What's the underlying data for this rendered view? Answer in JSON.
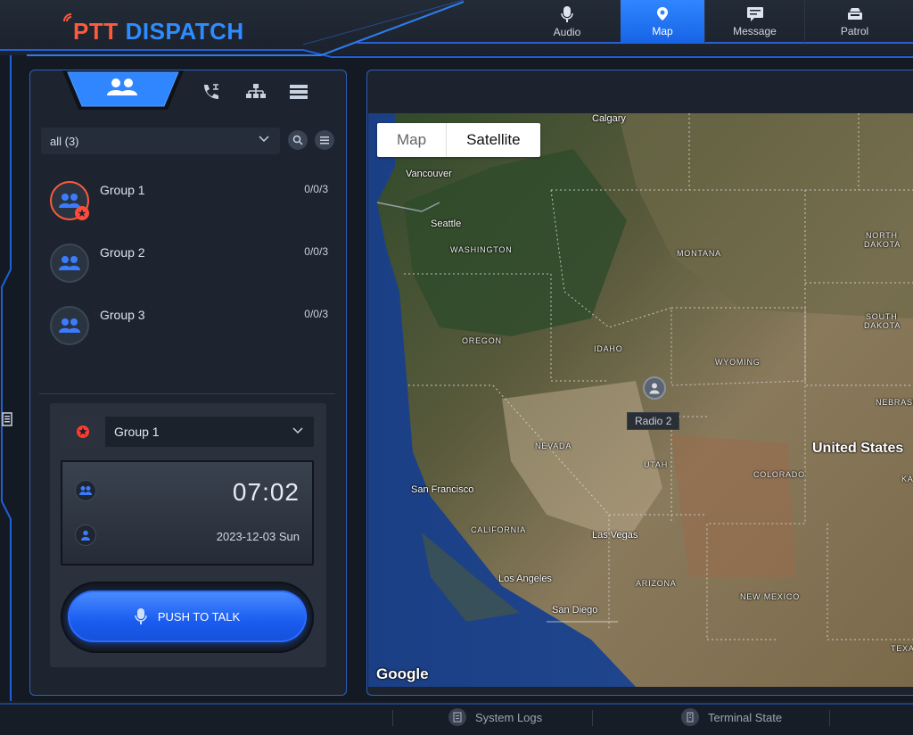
{
  "app": {
    "logo_ptt": "PTT",
    "logo_dispatch": "DISPATCH"
  },
  "nav": [
    {
      "label": "Audio",
      "icon": "microphone-icon"
    },
    {
      "label": "Map",
      "icon": "map-pin-icon",
      "active": true
    },
    {
      "label": "Message",
      "icon": "message-icon"
    },
    {
      "label": "Patrol",
      "icon": "patrol-icon"
    }
  ],
  "panel_tabs": [
    "users-group-icon",
    "phone-icon",
    "org-tree-icon",
    "server-list-icon"
  ],
  "filter": {
    "selected": "all (3)"
  },
  "groups": [
    {
      "name": "Group 1",
      "count": "0/0/3",
      "selected": true
    },
    {
      "name": "Group 2",
      "count": "0/0/3",
      "selected": false
    },
    {
      "name": "Group 3",
      "count": "0/0/3",
      "selected": false
    }
  ],
  "ptt": {
    "group": "Group 1",
    "time": "07:02",
    "date": "2023-12-03 Sun",
    "button_label": "PUSH TO TALK"
  },
  "map": {
    "toggle_map": "Map",
    "toggle_satellite": "Satellite",
    "active_view": "Satellite",
    "brand": "Google",
    "marker_label": "Radio 2",
    "cities": {
      "calgary": "Calgary",
      "vancouver": "Vancouver",
      "seattle": "Seattle",
      "san_francisco": "San Francisco",
      "las_vegas": "Las Vegas",
      "los_angeles": "Los Angeles",
      "san_diego": "San Diego"
    },
    "states": {
      "washington": "WASHINGTON",
      "montana": "MONTANA",
      "north_dakota_1": "NORTH",
      "north_dakota_2": "DAKOTA",
      "south_dakota_1": "SOUTH",
      "south_dakota_2": "DAKOTA",
      "oregon": "OREGON",
      "idaho": "IDAHO",
      "wyoming": "WYOMING",
      "nebraska": "NEBRASK",
      "nevada": "NEVADA",
      "utah": "UTAH",
      "colorado": "COLORADO",
      "kansas": "KA",
      "california": "CALIFORNIA",
      "arizona": "ARIZONA",
      "new_mexico": "NEW MEXICO",
      "texas": "TEXA"
    },
    "country": "United States"
  },
  "bottom": {
    "system_logs": "System Logs",
    "terminal_state": "Terminal State"
  },
  "colors": {
    "accent_blue": "#2f86ff",
    "brand_red": "#ff5a3c",
    "panel_bg": "#1d2430",
    "panel_border": "#2f5fb8"
  }
}
